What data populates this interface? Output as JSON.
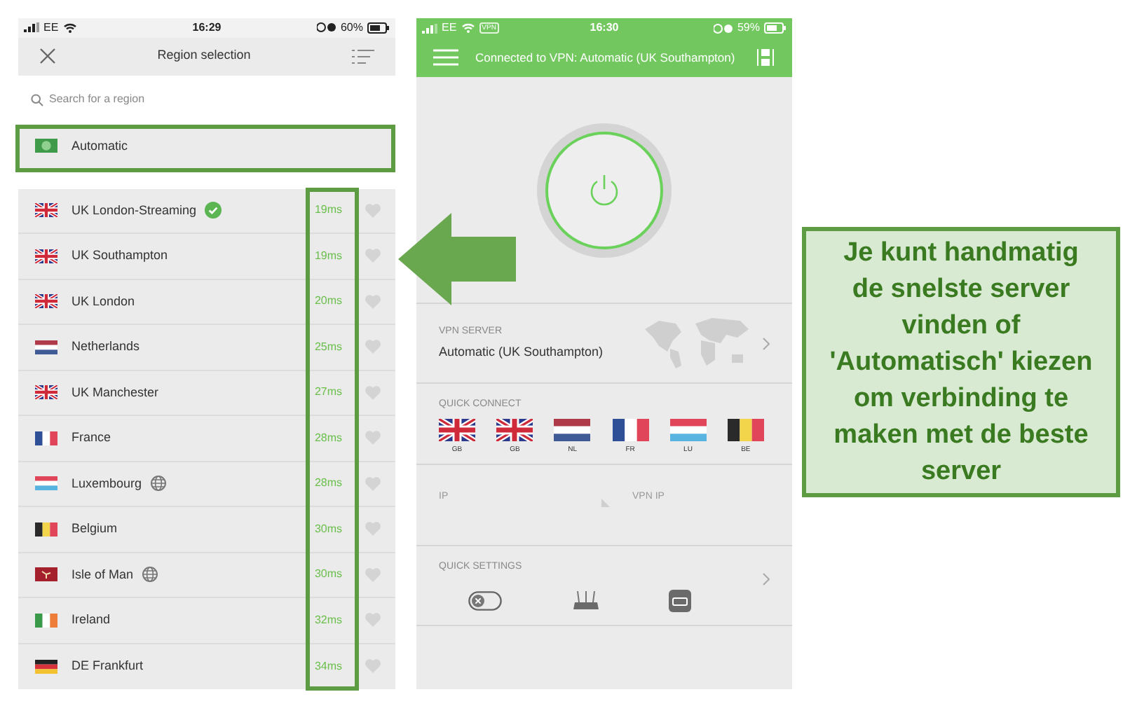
{
  "region_screen": {
    "status_bar": {
      "carrier": "EE",
      "time": "16:29",
      "battery": "60%"
    },
    "title": "Region selection",
    "search": {
      "placeholder": "Search for a region"
    },
    "automatic": {
      "label": "Automatic",
      "kind": "auto"
    },
    "regions": [
      {
        "name": "UK London-Streaming",
        "kind": "gb",
        "latency": "19ms",
        "connected": true,
        "globe": false,
        "favorite": false
      },
      {
        "name": "UK Southampton",
        "kind": "gb",
        "latency": "19ms",
        "connected": false,
        "globe": false,
        "favorite": false
      },
      {
        "name": "UK London",
        "kind": "gb",
        "latency": "20ms",
        "connected": false,
        "globe": false,
        "favorite": false
      },
      {
        "name": "Netherlands",
        "kind": "nl",
        "latency": "25ms",
        "connected": false,
        "globe": false,
        "favorite": false
      },
      {
        "name": "UK Manchester",
        "kind": "gb",
        "latency": "27ms",
        "connected": false,
        "globe": false,
        "favorite": false
      },
      {
        "name": "France",
        "kind": "fr",
        "latency": "28ms",
        "connected": false,
        "globe": false,
        "favorite": false
      },
      {
        "name": "Luxembourg",
        "kind": "lu",
        "latency": "28ms",
        "connected": false,
        "globe": true,
        "favorite": false
      },
      {
        "name": "Belgium",
        "kind": "be",
        "latency": "30ms",
        "connected": false,
        "globe": false,
        "favorite": false
      },
      {
        "name": "Isle of Man",
        "kind": "im",
        "latency": "30ms",
        "connected": false,
        "globe": true,
        "favorite": false
      },
      {
        "name": "Ireland",
        "kind": "ie",
        "latency": "32ms",
        "connected": false,
        "globe": false,
        "favorite": false
      },
      {
        "name": "DE Frankfurt",
        "kind": "de",
        "latency": "34ms",
        "connected": false,
        "globe": false,
        "favorite": false
      }
    ]
  },
  "vpn_screen": {
    "status_bar": {
      "carrier": "EE",
      "vpn_badge": "VPN",
      "time": "16:30",
      "battery": "59%"
    },
    "title": "Connected to VPN: Automatic (UK Southampton)",
    "vpn_server": {
      "label": "VPN SERVER",
      "value": "Automatic (UK Southampton)"
    },
    "quick_connect": {
      "label": "QUICK CONNECT",
      "flags": [
        {
          "code": "GB",
          "kind": "gb"
        },
        {
          "code": "GB",
          "kind": "gb"
        },
        {
          "code": "NL",
          "kind": "nl"
        },
        {
          "code": "FR",
          "kind": "fr"
        },
        {
          "code": "LU",
          "kind": "lu"
        },
        {
          "code": "BE",
          "kind": "be"
        }
      ]
    },
    "ip": {
      "label": "IP",
      "vpn_label": "VPN IP"
    },
    "quick_settings": {
      "label": "QUICK SETTINGS"
    }
  },
  "annotation": {
    "text": "Je kunt handmatig de snelste server vinden of 'Automatisch' kiezen om verbinding te maken met de beste server"
  }
}
